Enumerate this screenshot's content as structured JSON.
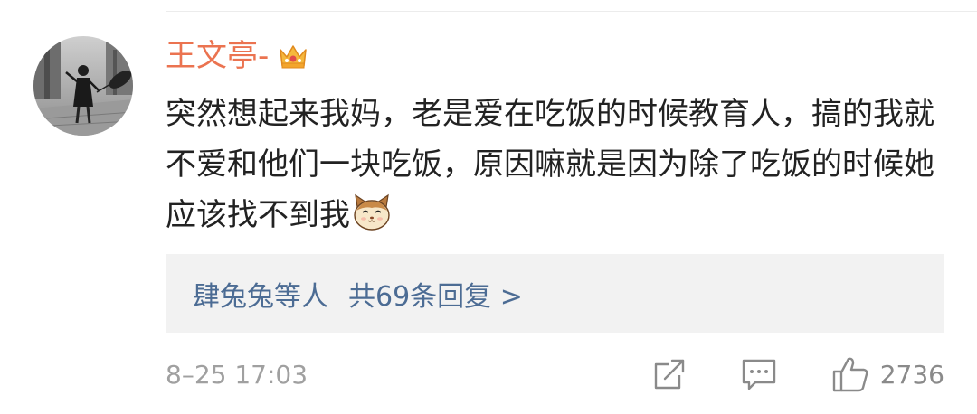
{
  "comment": {
    "username": "王文亭-",
    "badge_icon": "crown-badge-icon",
    "text": "突然想起来我妈，老是爱在吃饭的时候教育人，搞的我就不爱和他们一块吃饭，原因嘛就是因为除了吃饭的时候她应该找不到我",
    "text_emoji_icon": "cat-emoji-icon",
    "colors": {
      "username": "#eb7350",
      "reply_link": "#4c6c94",
      "meta": "#a0a0a0"
    }
  },
  "replies": {
    "users_label": "肆兔兔等人",
    "count_label": "共69条回复 >"
  },
  "footer": {
    "timestamp": "8–25 17:03",
    "share_icon": "share-icon",
    "comment_icon": "comment-icon",
    "like_icon": "thumbs-up-icon",
    "like_count": "2736"
  }
}
